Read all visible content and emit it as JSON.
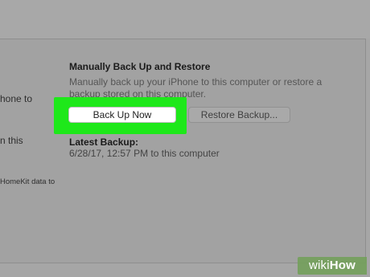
{
  "backup_section": {
    "heading": "Manually Back Up and Restore",
    "description": "Manually back up your iPhone to this computer or restore a backup stored on this computer.",
    "back_up_now_label": "Back Up Now",
    "restore_backup_label": "Restore Backup...",
    "latest_backup_label": "Latest Backup:",
    "latest_backup_value": "6/28/17, 12:57 PM to this computer",
    "highlight_color": "#1ee81a"
  },
  "left_column": {
    "line1": "hone to",
    "line2": "n this",
    "line3": "HomeKit data to"
  },
  "watermark": {
    "part1": "wiki",
    "part2": "How"
  }
}
